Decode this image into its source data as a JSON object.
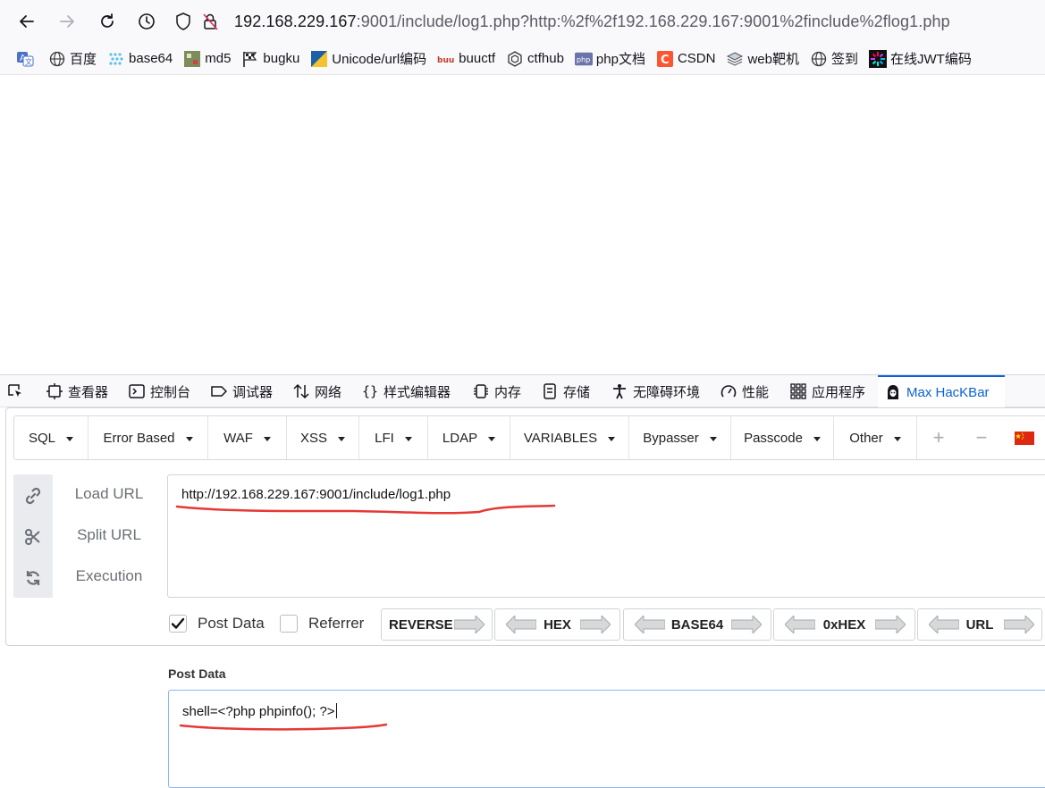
{
  "browser": {
    "url_host": "192.168.229.167",
    "url_rest": ":9001/include/log1.php?http:%2f%2f192.168.229.167:9001%2finclude%2flog1.php"
  },
  "bookmarks": [
    {
      "label": "",
      "icon": "translate-icon"
    },
    {
      "label": "百度",
      "icon": "globe-icon"
    },
    {
      "label": "base64",
      "icon": "dots-icon"
    },
    {
      "label": "md5",
      "icon": "md5-icon"
    },
    {
      "label": "bugku",
      "icon": "flag-icon"
    },
    {
      "label": "Unicode/url编码",
      "icon": "unicode-icon"
    },
    {
      "label": "buuctf",
      "icon": "buuctf-icon"
    },
    {
      "label": "ctfhub",
      "icon": "hex-icon"
    },
    {
      "label": "php文档",
      "icon": "php-icon"
    },
    {
      "label": "CSDN",
      "icon": "csdn-icon"
    },
    {
      "label": "web靶机",
      "icon": "layers-icon"
    },
    {
      "label": "签到",
      "icon": "globe-icon"
    },
    {
      "label": "在线JWT编码",
      "icon": "jwt-icon"
    }
  ],
  "devtools": {
    "tabs": [
      {
        "label": "",
        "icon": "pick-element-icon"
      },
      {
        "label": "查看器",
        "icon": "inspector-icon"
      },
      {
        "label": "控制台",
        "icon": "console-icon"
      },
      {
        "label": "调试器",
        "icon": "debugger-icon"
      },
      {
        "label": "网络",
        "icon": "network-icon"
      },
      {
        "label": "样式编辑器",
        "icon": "style-editor-icon"
      },
      {
        "label": "内存",
        "icon": "memory-icon"
      },
      {
        "label": "存储",
        "icon": "storage-icon"
      },
      {
        "label": "无障碍环境",
        "icon": "accessibility-icon"
      },
      {
        "label": "性能",
        "icon": "performance-icon"
      },
      {
        "label": "应用程序",
        "icon": "application-icon"
      },
      {
        "label": "Max HacKBar",
        "icon": "hacker-icon"
      }
    ],
    "active_tab": "Max HacKBar"
  },
  "hackbar": {
    "menu": [
      "SQL",
      "Error Based",
      "WAF",
      "XSS",
      "LFI",
      "LDAP",
      "VARIABLES",
      "Bypasser",
      "Passcode",
      "Other"
    ],
    "side_actions": [
      "Load URL",
      "Split URL",
      "Execution"
    ],
    "url_value": "http://192.168.229.167:9001/include/log1.php",
    "post_data_checkbox": {
      "label": "Post Data",
      "checked": true
    },
    "referrer_checkbox": {
      "label": "Referrer",
      "checked": false
    },
    "encoders": [
      "REVERSE",
      "HEX",
      "BASE64",
      "0xHEX",
      "URL"
    ],
    "post_data_label": "Post Data",
    "post_data_value": "shell=<?php phpinfo(); ?>"
  },
  "colors": {
    "accent": "#0a62d6",
    "annotation": "#e53935",
    "flag_red": "#de2910",
    "flag_yellow": "#ffde00"
  }
}
